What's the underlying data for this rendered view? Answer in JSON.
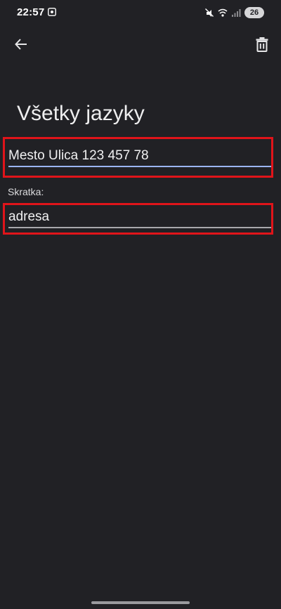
{
  "status_bar": {
    "time": "22:57",
    "battery_level": "26",
    "icons": [
      "screen-record-icon",
      "silent-icon",
      "wifi-icon",
      "signal-icon",
      "battery-icon"
    ]
  },
  "toolbar": {
    "back_icon": "arrow-left-icon",
    "delete_icon": "trash-icon"
  },
  "page": {
    "title": "Všetky jazyky"
  },
  "form": {
    "phrase_value": "Mesto Ulica 123 457 78",
    "shortcut_label": "Skratka:",
    "shortcut_value": "adresa"
  },
  "colors": {
    "background": "#212125",
    "highlight_border": "#e0141a",
    "focused_underline": "#9bb4f4",
    "underline": "#a8a8ac"
  }
}
